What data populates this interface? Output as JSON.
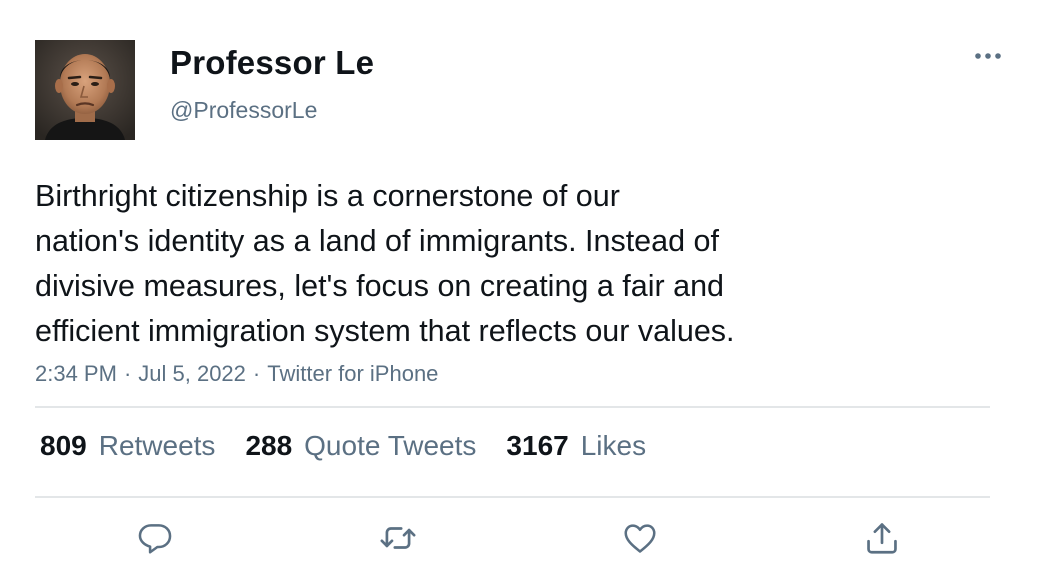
{
  "user": {
    "display_name": "Professor Le",
    "handle": "@ProfessorLe"
  },
  "tweet": {
    "text_lines": [
      "Birthright citizenship is a cornerstone of our",
      "nation's identity as a land of immigrants. Instead of",
      "divisive measures, let's focus on creating a fair and",
      "efficient immigration system that reflects our values."
    ],
    "time": "2:34 PM",
    "date": "Jul 5, 2022",
    "source": "Twitter for iPhone",
    "separator": "·"
  },
  "stats": {
    "retweets": {
      "count": "809",
      "label": "Retweets"
    },
    "quote_tweets": {
      "count": "288",
      "label": "Quote Tweets"
    },
    "likes": {
      "count": "3167",
      "label": "Likes"
    }
  },
  "icons": {
    "more": "more-horizontal-icon",
    "reply": "reply-icon",
    "retweet": "retweet-icon",
    "like": "heart-icon",
    "share": "share-icon"
  },
  "colors": {
    "text_primary": "#0f1419",
    "text_secondary": "#5b7083",
    "divider": "#e3e6e8",
    "icon": "#5b7083"
  }
}
